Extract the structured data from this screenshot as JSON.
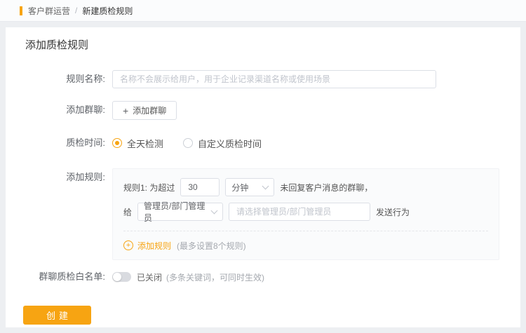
{
  "colors": {
    "accent": "#F7A412",
    "page_bg": "#EDEFF2",
    "card_bg": "#FFFFFF",
    "rule_box_bg": "#FAFBFC"
  },
  "breadcrumb": {
    "root": "客户群运营",
    "separator": "/",
    "current": "新建质检规则"
  },
  "page": {
    "title": "添加质检规则"
  },
  "form": {
    "rule_name": {
      "label": "规则名称:",
      "value": "",
      "placeholder": "名称不会展示给用户，用于企业记录渠道名称或使用场景"
    },
    "add_group": {
      "label": "添加群聊:",
      "button_label": "添加群聊",
      "plus_icon": "+"
    },
    "qc_time": {
      "label": "质检时间:",
      "options": [
        {
          "label": "全天检测",
          "selected": true
        },
        {
          "label": "自定义质检时间",
          "selected": false
        }
      ]
    },
    "add_rules": {
      "label": "添加规则:",
      "rule": {
        "prefix": "规则1: 为超过",
        "threshold_value": "30",
        "unit_value": "分钟",
        "suffix": "未回复客户消息的群聊，",
        "to_label": "给",
        "receiver_value": "管理员/部门管理员",
        "receiver_placeholder": "请选择管理员/部门管理员",
        "action_suffix": "发送行为"
      },
      "add_link_label": "添加规则",
      "add_link_hint": "(最多设置8个规则)",
      "plus_icon": "+"
    },
    "whitelist": {
      "label": "群聊质检白名单:",
      "state": "已关闭",
      "hint": "(多条关键词，可同时生效)"
    }
  },
  "actions": {
    "create_label": "创建"
  }
}
